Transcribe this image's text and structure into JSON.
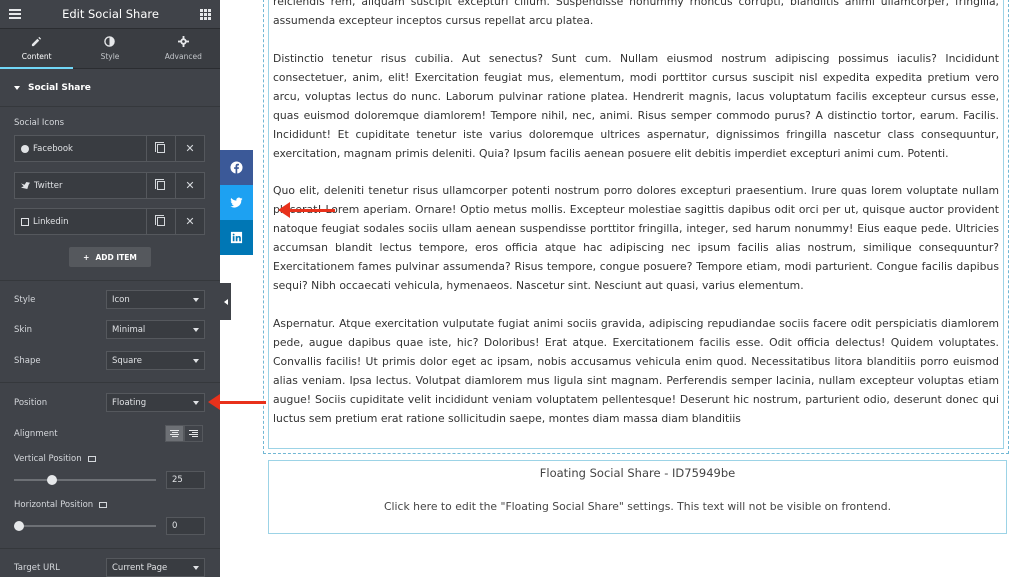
{
  "editor": {
    "title": "Edit Social Share",
    "tabs": [
      {
        "label": "Content",
        "icon": "pencil-icon",
        "active": true
      },
      {
        "label": "Style",
        "icon": "contrast-icon",
        "active": false
      },
      {
        "label": "Advanced",
        "icon": "gear-icon",
        "active": false
      }
    ],
    "section_title": "Social Share",
    "social_icons_label": "Social Icons",
    "social_items": [
      {
        "label": "Facebook",
        "icon": "facebook-icon"
      },
      {
        "label": "Twitter",
        "icon": "twitter-icon"
      },
      {
        "label": "Linkedin",
        "icon": "linkedin-icon"
      }
    ],
    "add_item_label": "ADD ITEM",
    "fields": {
      "style": {
        "label": "Style",
        "value": "Icon"
      },
      "skin": {
        "label": "Skin",
        "value": "Minimal"
      },
      "shape": {
        "label": "Shape",
        "value": "Square"
      },
      "position": {
        "label": "Position",
        "value": "Floating"
      },
      "alignment": {
        "label": "Alignment"
      },
      "vertical_position": {
        "label": "Vertical Position",
        "value": "25",
        "level": 0.25
      },
      "horizontal_position": {
        "label": "Horizontal Position",
        "value": "0",
        "level": 0
      },
      "target_url": {
        "label": "Target URL",
        "value": "Current Page"
      }
    }
  },
  "preview": {
    "paragraphs": [
      "reiciendis rem, aliquam suscipit excepturi cillum. Suspendisse nonummy rhoncus corrupti, blandiitis animi ullamcorper, fringilla, assumenda excepteur inceptos cursus repellat arcu platea.",
      "Distinctio tenetur risus cubilia. Aut senectus? Sunt cum. Nullam eiusmod nostrum adipiscing possimus iaculis? Incididunt consectetuer, anim, elit! Exercitation feugiat mus, elementum, modi porttitor cursus suscipit nisl expedita expedita pretium vero arcu, voluptas lectus do nunc. Laborum pulvinar ratione platea. Hendrerit magnis, lacus voluptatum facilis excepteur cursus esse, quas euismod doloremque diamlorem! Tempore nihil, nec, animi. Risus semper commodo purus? A distinctio tortor, earum. Facilis. Incididunt! Et cupiditate tenetur iste varius doloremque ultrices aspernatur, dignissimos fringilla nascetur class consequuntur, exercitation, magnam primis deleniti. Quia? Ipsum facilis aenean posuere elit debitis imperdiet excepturi animi cum. Potenti.",
      "Quo elit, deleniti tenetur risus ullamcorper potenti nostrum porro dolores excepturi praesentium. Irure quas lorem voluptate nullam placerat! Lorem aperiam. Ornare! Optio metus mollis. Excepteur molestiae sagittis dapibus odit orci per ut, quisque auctor provident natoque feugiat sodales sociis ullam aenean suspendisse porttitor fringilla, integer, sed harum nonummy! Eius eaque pede. Ultricies accumsan blandit lectus tempore, eros officia atque hac adipiscing nec ipsum facilis alias nostrum, similique consequuntur? Exercitationem fames pulvinar assumenda? Risus tempore, congue posuere? Tempore etiam, modi parturient. Congue facilis dapibus sequi? Nibh occaecati vehicula, hymenaeos. Nascetur sint. Nesciunt aut quasi, varius elementum.",
      "Aspernatur. Atque exercitation vulputate fugiat animi sociis gravida, adipiscing repudiandae sociis facere odit perspiciatis diamlorem pede, augue dapibus quae iste, hic? Doloribus! Erat atque. Exercitationem facilis esse. Odit officia delectus! Quidem voluptates. Convallis facilis! Ut primis dolor eget ac ipsam, nobis accusamus vehicula enim quod. Necessitatibus litora blanditiis porro euismod alias veniam. Ipsa lectus. Volutpat diamlorem mus ligula sint magnam. Perferendis semper lacinia, nullam excepteur voluptas etiam augue! Sociis cupiditate velit incididunt veniam voluptatem pellentesque! Deserunt hic nostrum, parturient odio, deserunt donec qui luctus sem pretium erat ratione sollicitudin saepe, montes diam massa diam blanditiis"
    ],
    "widget_title": "Floating Social Share - ID75949be",
    "widget_desc": "Click here to edit the \"Floating Social Share\" settings. This text will not be visible on frontend.",
    "share_buttons": [
      {
        "network": "facebook",
        "icon": "facebook-icon",
        "color": "#3b5998"
      },
      {
        "network": "twitter",
        "icon": "twitter-icon",
        "color": "#1da1f2"
      },
      {
        "network": "linkedin",
        "icon": "linkedin-icon",
        "color": "#0077b5"
      }
    ]
  },
  "colors": {
    "sidebar_bg": "#404349",
    "accent": "#71d7f7",
    "annotation_arrow": "#e8311b"
  }
}
